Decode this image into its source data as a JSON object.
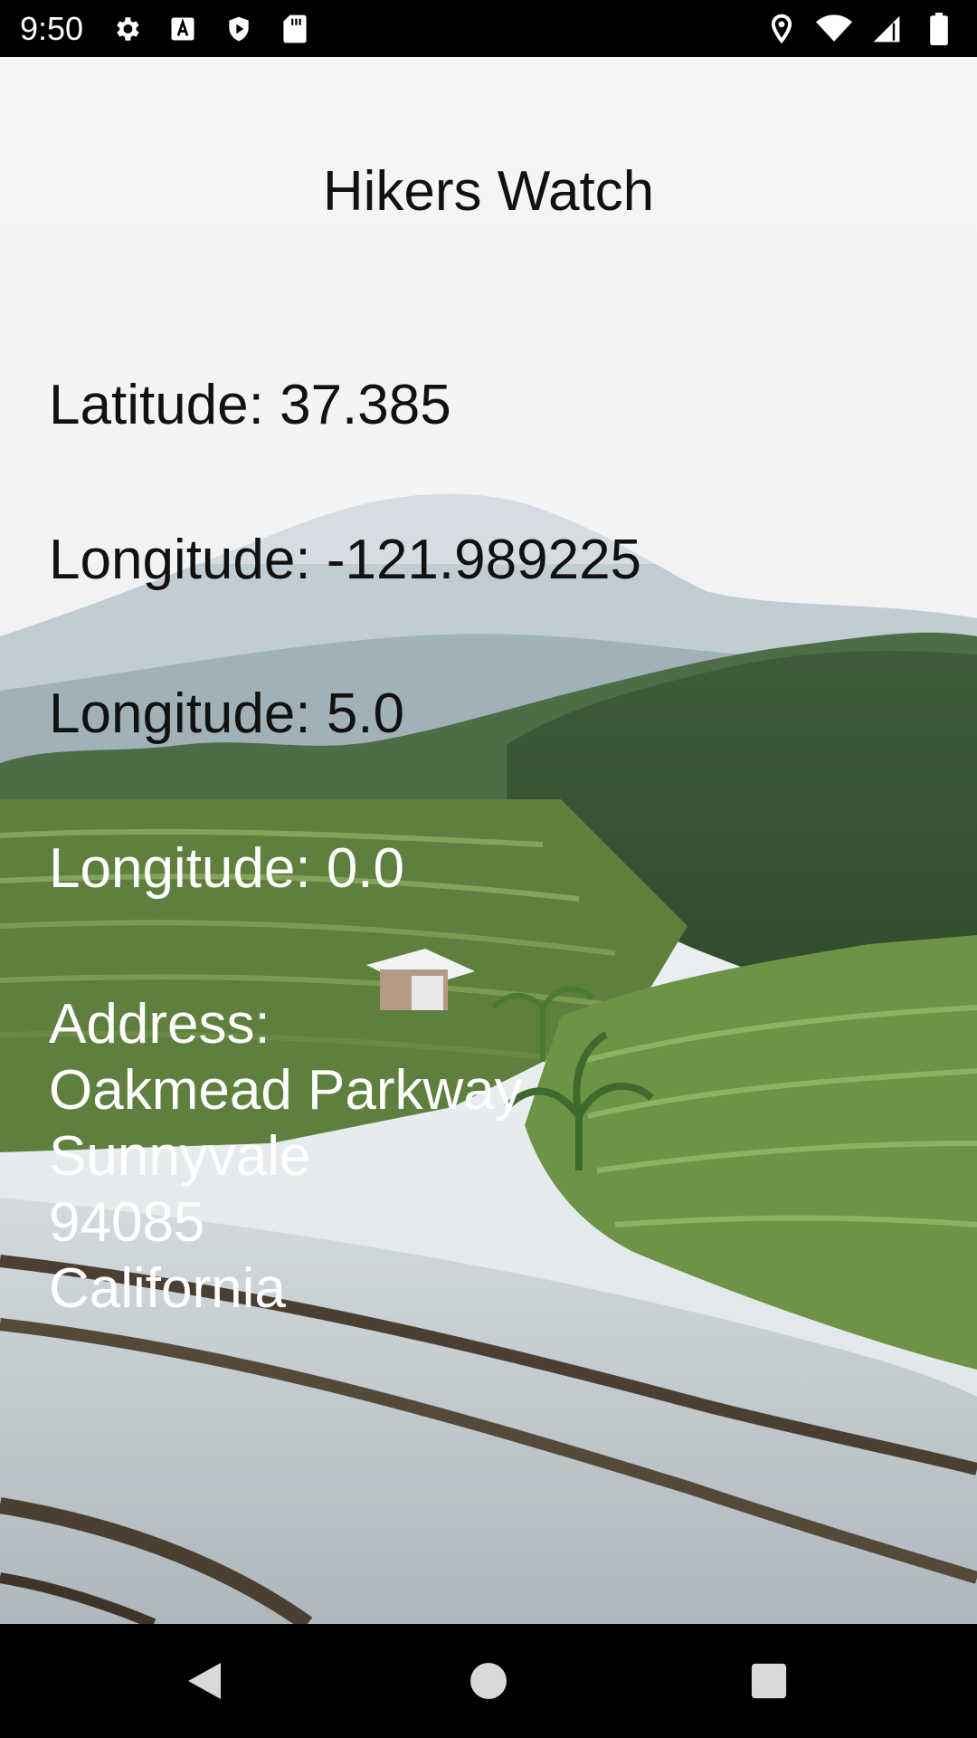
{
  "status_bar": {
    "time": "9:50",
    "left_icons": [
      "gear-icon",
      "text-a-icon",
      "shield-play-icon",
      "sd-card-icon"
    ],
    "right_icons": [
      "location-pin-icon",
      "wifi-icon",
      "signal-icon",
      "battery-icon"
    ]
  },
  "app": {
    "title": "Hikers Watch",
    "latitude_label": "Latitude: 37.385",
    "longitude_label": "Longitude: -121.989225",
    "accuracy_label": "Longitude: 5.0",
    "altitude_label": "Longitude: 0.0",
    "address": {
      "heading": "Address:",
      "lines": [
        "Oakmead Parkway",
        "Sunnyvale",
        "94085",
        "California"
      ]
    }
  },
  "nav_bar": {
    "buttons": [
      "back-icon",
      "home-icon",
      "recents-icon"
    ]
  },
  "colors": {
    "sky": "#f1f2f4",
    "mountain": "#9fb0b8",
    "forest": "#3d5a36",
    "terrace": "#6f8f4a",
    "water": "#c9cfd3"
  }
}
